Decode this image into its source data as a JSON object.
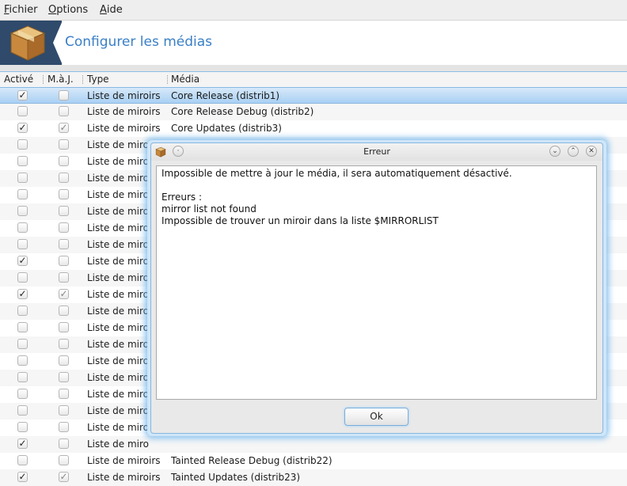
{
  "menubar": {
    "items": [
      {
        "mnemonic": "F",
        "rest": "ichier"
      },
      {
        "mnemonic": "O",
        "rest": "ptions"
      },
      {
        "mnemonic": "A",
        "rest": "ide"
      }
    ]
  },
  "header": {
    "title": "Configurer les médias",
    "icon": "package-box-icon"
  },
  "table": {
    "columns": [
      "Activé",
      "M.à.J.",
      "Type",
      "Média"
    ],
    "rows": [
      {
        "enabled": true,
        "update": false,
        "type": "Liste de miroirs",
        "media": "Core Release (distrib1)"
      },
      {
        "enabled": false,
        "update": false,
        "type": "Liste de miroirs",
        "media": "Core Release Debug (distrib2)"
      },
      {
        "enabled": true,
        "update": true,
        "type": "Liste de miroirs",
        "media": "Core Updates (distrib3)"
      },
      {
        "enabled": false,
        "update": false,
        "type": "Liste de miro",
        "media": ""
      },
      {
        "enabled": false,
        "update": false,
        "type": "Liste de miro",
        "media": ""
      },
      {
        "enabled": false,
        "update": false,
        "type": "Liste de miro",
        "media": ""
      },
      {
        "enabled": false,
        "update": false,
        "type": "Liste de miro",
        "media": ""
      },
      {
        "enabled": false,
        "update": false,
        "type": "Liste de miro",
        "media": ""
      },
      {
        "enabled": false,
        "update": false,
        "type": "Liste de miro",
        "media": ""
      },
      {
        "enabled": false,
        "update": false,
        "type": "Liste de miro",
        "media": ""
      },
      {
        "enabled": true,
        "update": false,
        "type": "Liste de miro",
        "media": ""
      },
      {
        "enabled": false,
        "update": false,
        "type": "Liste de miro",
        "media": ""
      },
      {
        "enabled": true,
        "update": true,
        "type": "Liste de miro",
        "media": ""
      },
      {
        "enabled": false,
        "update": false,
        "type": "Liste de miro",
        "media": ""
      },
      {
        "enabled": false,
        "update": false,
        "type": "Liste de miro",
        "media": ""
      },
      {
        "enabled": false,
        "update": false,
        "type": "Liste de miro",
        "media": ""
      },
      {
        "enabled": false,
        "update": false,
        "type": "Liste de miro",
        "media": ""
      },
      {
        "enabled": false,
        "update": false,
        "type": "Liste de miro",
        "media": ""
      },
      {
        "enabled": false,
        "update": false,
        "type": "Liste de miro",
        "media": ""
      },
      {
        "enabled": false,
        "update": false,
        "type": "Liste de miro",
        "media": ""
      },
      {
        "enabled": false,
        "update": false,
        "type": "Liste de miro",
        "media": ""
      },
      {
        "enabled": true,
        "update": false,
        "type": "Liste de miro",
        "media": ""
      },
      {
        "enabled": false,
        "update": false,
        "type": "Liste de miroirs",
        "media": "Tainted Release Debug (distrib22)"
      },
      {
        "enabled": true,
        "update": true,
        "type": "Liste de miroirs",
        "media": "Tainted Updates (distrib23)"
      }
    ]
  },
  "dialog": {
    "title": "Erreur",
    "message": "Impossible de mettre à jour le média, il sera automatiquement désactivé.\n\nErreurs :\nmirror list not found\nImpossible de trouver un miroir dans la liste $MIRRORLIST",
    "ok_label": "Ok"
  },
  "colors": {
    "accent": "#3a7fc6",
    "selection": "#a9d0f3",
    "header_icon_bg": "#2f4a6b"
  }
}
